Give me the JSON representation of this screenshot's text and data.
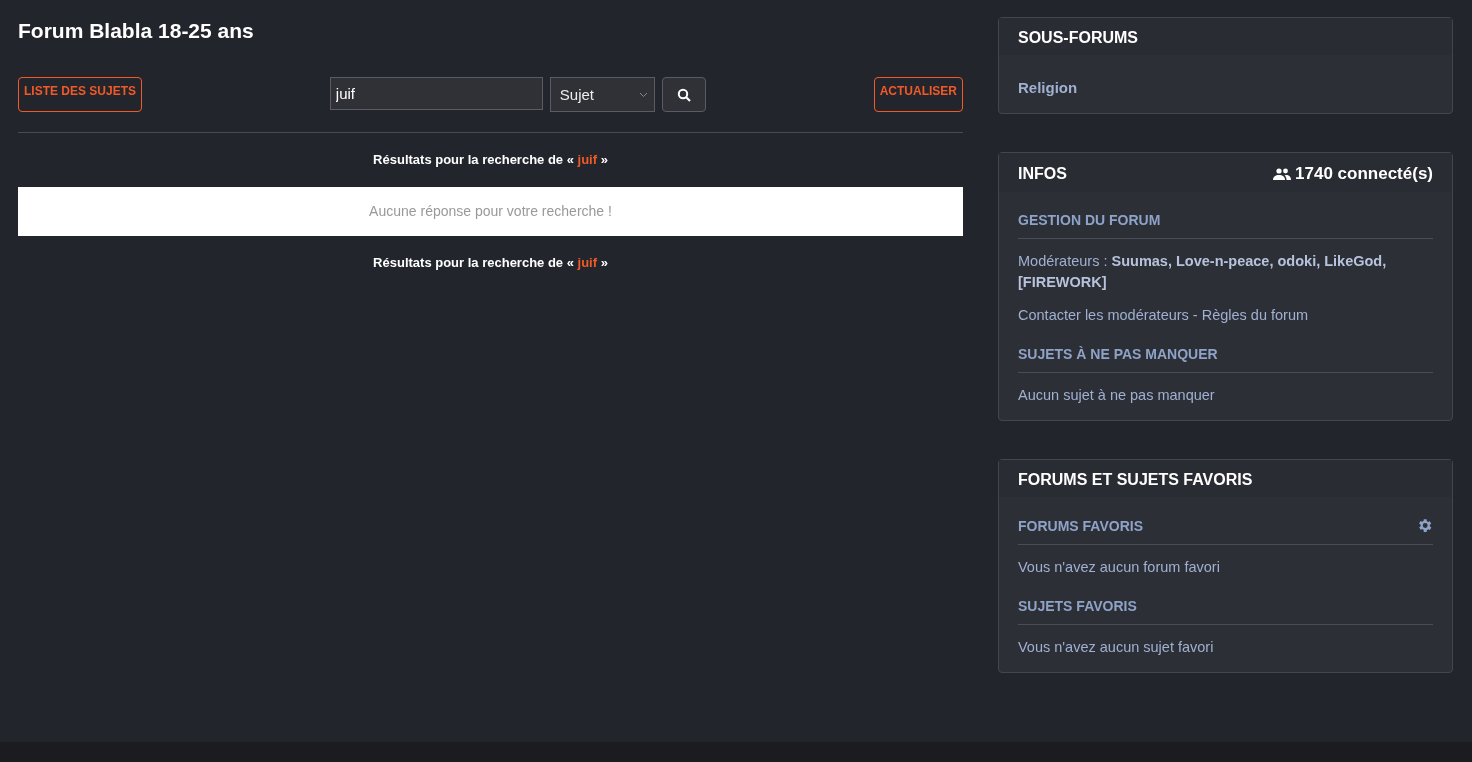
{
  "title": "Forum Blabla 18-25 ans",
  "toolbar": {
    "list_button": "LISTE DES SUJETS",
    "search": {
      "value": "juif"
    },
    "search_type": "Sujet",
    "refresh_button": "ACTUALISER"
  },
  "results": [
    {
      "prefix": "Résultats pour la recherche de «",
      "term": "juif",
      "suffix": "»"
    },
    {
      "kind": "empty",
      "text": "Aucune réponse pour votre recherche !"
    },
    {
      "prefix": "Résultats pour la recherche de «",
      "term": "juif",
      "suffix": "»"
    }
  ],
  "sidebar": [
    {
      "title": "SOUS-FORUMS",
      "sections": [
        {
          "items": [
            {
              "kind": "link",
              "text": "Religion"
            }
          ]
        }
      ]
    },
    {
      "title": "INFOS",
      "online": "1740 connecté(s)",
      "sections": [
        {
          "heading": "GESTION DU FORUM",
          "items": [
            {
              "kind": "text",
              "text": "Modérateurs : **Suumas, Love-n-peace, odoki, LikeGod, [FIREWORK]**"
            },
            {
              "kind": "links",
              "links": [
                "Contacter les modérateurs",
                "Règles du forum"
              ],
              "separator": "-"
            }
          ]
        },
        {
          "heading": "SUJETS À NE PAS MANQUER",
          "items": [
            {
              "kind": "text",
              "text": "Aucun sujet à ne pas manquer"
            }
          ]
        }
      ]
    },
    {
      "title": "FORUMS ET SUJETS FAVORIS",
      "sections": [
        {
          "heading": "FORUMS FAVORIS",
          "settings": true,
          "items": [
            {
              "kind": "text",
              "text": "Vous n'avez aucun forum favori"
            }
          ]
        },
        {
          "heading": "SUJETS FAVORIS",
          "items": [
            {
              "kind": "text",
              "text": "Vous n'avez aucun sujet favori"
            }
          ]
        }
      ]
    }
  ]
}
